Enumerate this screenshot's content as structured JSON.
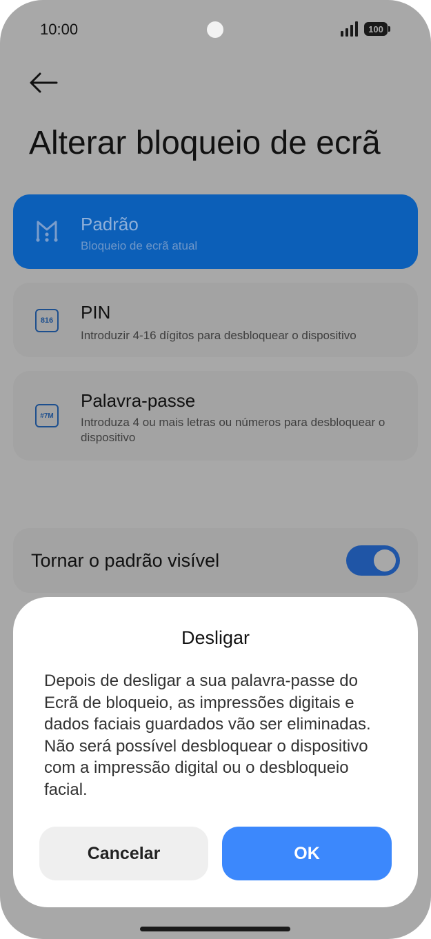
{
  "status_bar": {
    "time": "10:00",
    "battery": "100"
  },
  "header": {
    "title": "Alterar bloqueio de ecrã"
  },
  "options": [
    {
      "title": "Padrão",
      "subtitle": "Bloqueio de ecrã atual",
      "icon": "pattern-icon",
      "selected": true
    },
    {
      "title": "PIN",
      "subtitle": "Introduzir 4-16 dígitos para desbloquear o dispositivo",
      "icon": "pin-icon",
      "icon_text": "816",
      "selected": false
    },
    {
      "title": "Palavra-passe",
      "subtitle": "Introduza 4 ou mais letras ou números para desbloquear o dispositivo",
      "icon": "password-icon",
      "icon_text": "#7M",
      "selected": false
    }
  ],
  "visible_pattern": {
    "label": "Tornar o padrão visível",
    "enabled": true
  },
  "dialog": {
    "title": "Desligar",
    "message": "Depois de desligar a sua palavra-passe do Ecrã de bloqueio, as impressões digitais e dados faciais guardados vão ser eliminadas. Não será possível desbloquear o dispositivo com a impressão digital ou o desbloqueio facial.",
    "cancel_label": "Cancelar",
    "ok_label": "OK"
  },
  "colors": {
    "selected": "#0c5fb8",
    "accent": "#3c88fc",
    "scrim": "#a8a8a8",
    "toggle_on": "#1f55a6"
  }
}
